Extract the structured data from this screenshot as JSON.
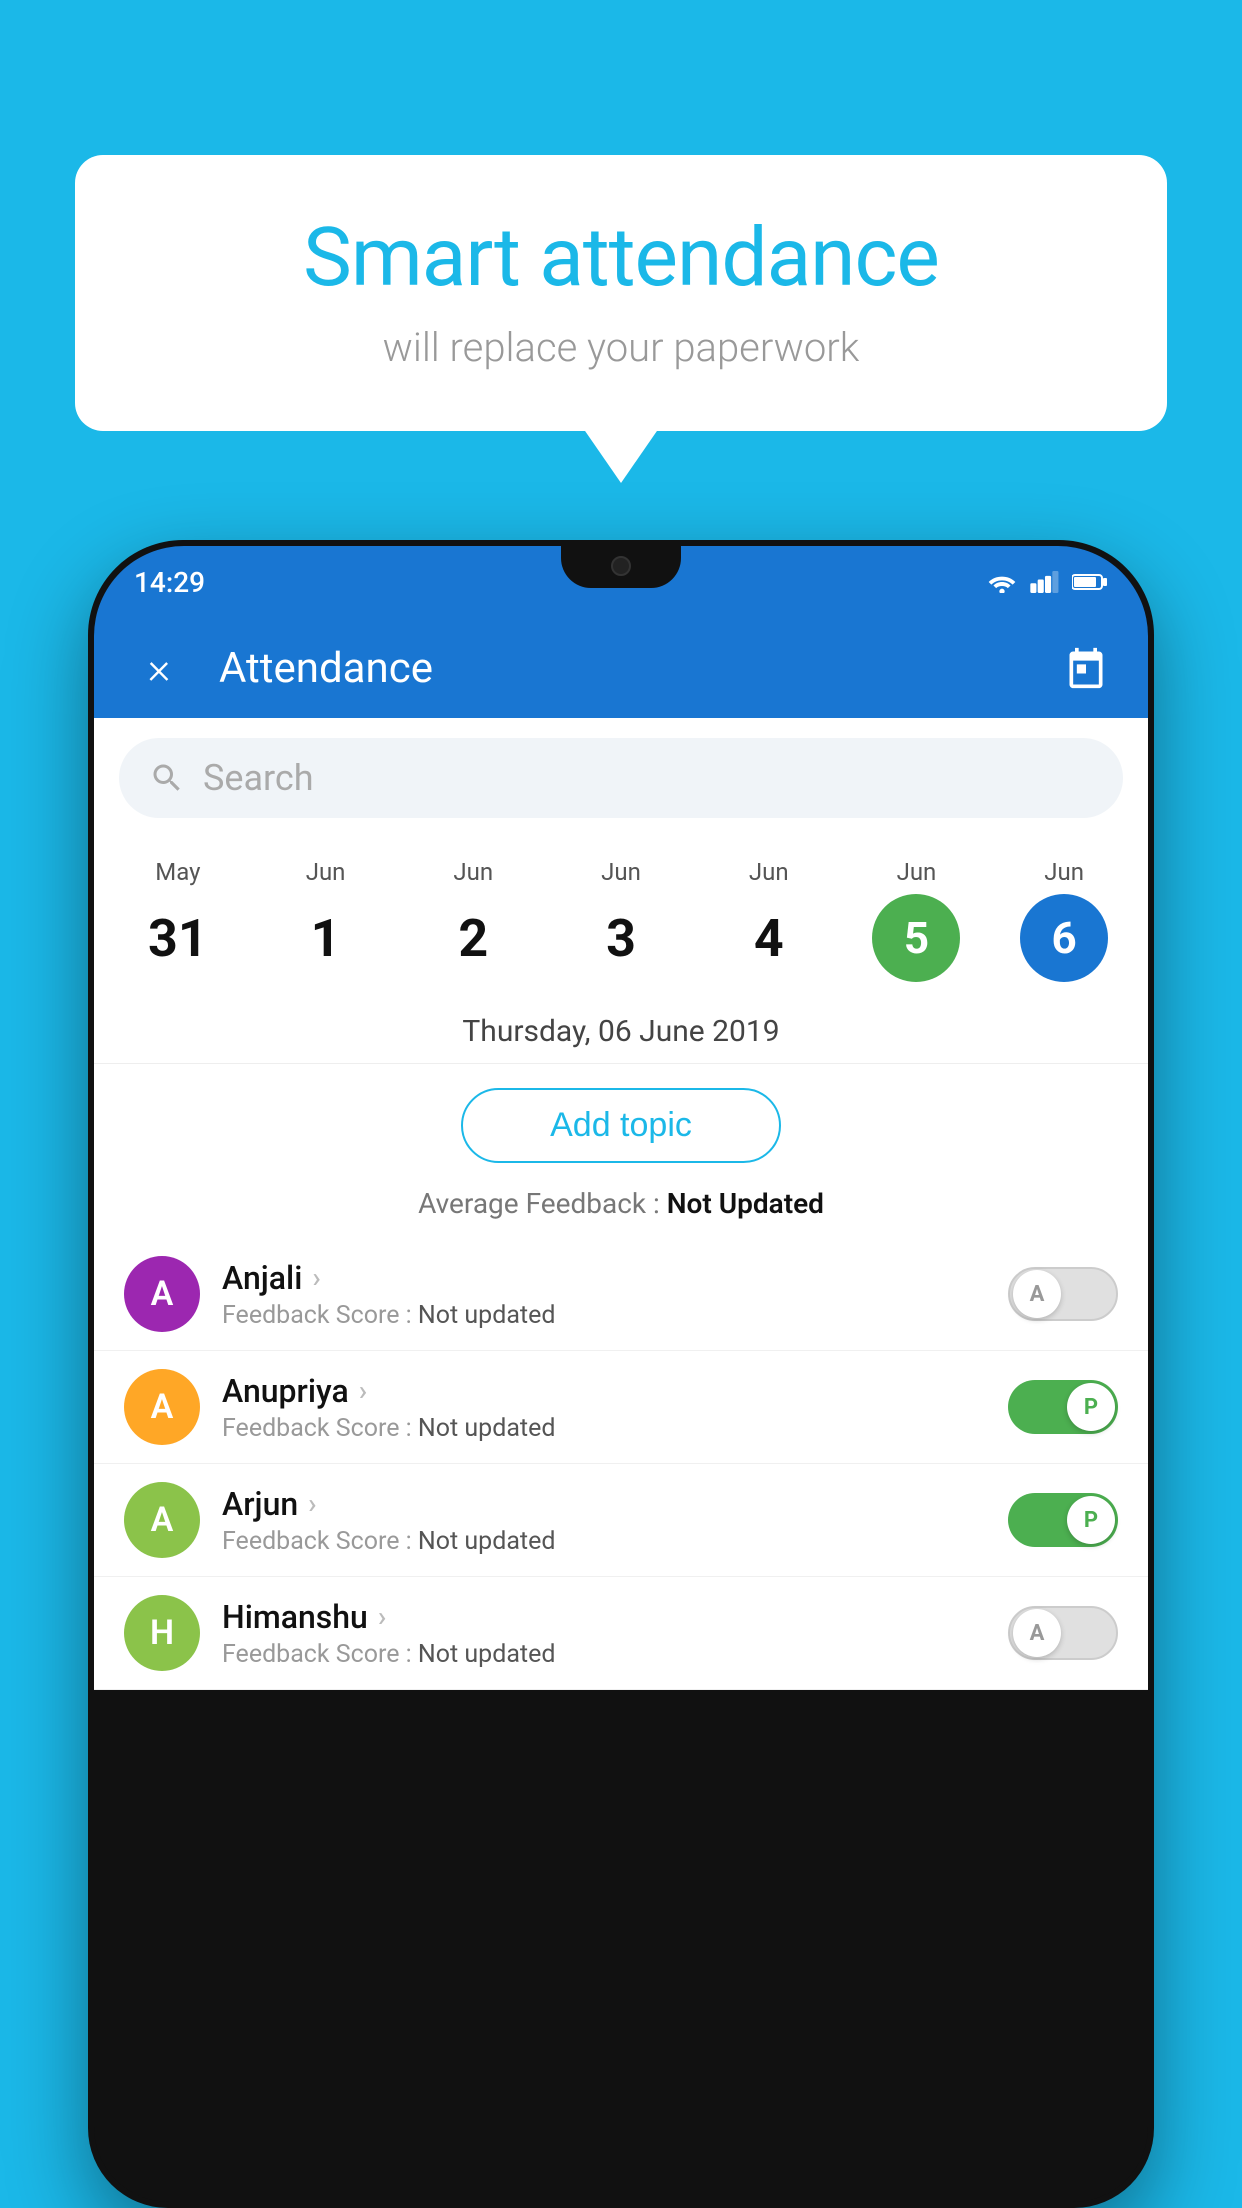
{
  "background_color": "#1bb8e8",
  "bubble": {
    "title": "Smart attendance",
    "subtitle": "will replace your paperwork"
  },
  "status_bar": {
    "time": "14:29",
    "wifi": "wifi",
    "signal": "signal",
    "battery": "battery"
  },
  "app_bar": {
    "close_label": "×",
    "title": "Attendance",
    "calendar_icon": "calendar"
  },
  "search": {
    "placeholder": "Search"
  },
  "date_strip": [
    {
      "month": "May",
      "day": "31",
      "style": "normal"
    },
    {
      "month": "Jun",
      "day": "1",
      "style": "normal"
    },
    {
      "month": "Jun",
      "day": "2",
      "style": "normal"
    },
    {
      "month": "Jun",
      "day": "3",
      "style": "normal"
    },
    {
      "month": "Jun",
      "day": "4",
      "style": "normal"
    },
    {
      "month": "Jun",
      "day": "5",
      "style": "green"
    },
    {
      "month": "Jun",
      "day": "6",
      "style": "blue"
    }
  ],
  "selected_date": "Thursday, 06 June 2019",
  "add_topic_label": "Add topic",
  "avg_feedback_label": "Average Feedback :",
  "avg_feedback_value": "Not Updated",
  "students": [
    {
      "name": "Anjali",
      "avatar_letter": "A",
      "avatar_color": "#9c27b0",
      "feedback_label": "Feedback Score :",
      "feedback_value": "Not updated",
      "toggle": "off",
      "toggle_letter": "A"
    },
    {
      "name": "Anupriya",
      "avatar_letter": "A",
      "avatar_color": "#ffa726",
      "feedback_label": "Feedback Score :",
      "feedback_value": "Not updated",
      "toggle": "on",
      "toggle_letter": "P"
    },
    {
      "name": "Arjun",
      "avatar_letter": "A",
      "avatar_color": "#8bc34a",
      "feedback_label": "Feedback Score :",
      "feedback_value": "Not updated",
      "toggle": "on",
      "toggle_letter": "P"
    },
    {
      "name": "Himanshu",
      "avatar_letter": "H",
      "avatar_color": "#8bc34a",
      "feedback_label": "Feedback Score :",
      "feedback_value": "Not updated",
      "toggle": "off",
      "toggle_letter": "A"
    }
  ]
}
